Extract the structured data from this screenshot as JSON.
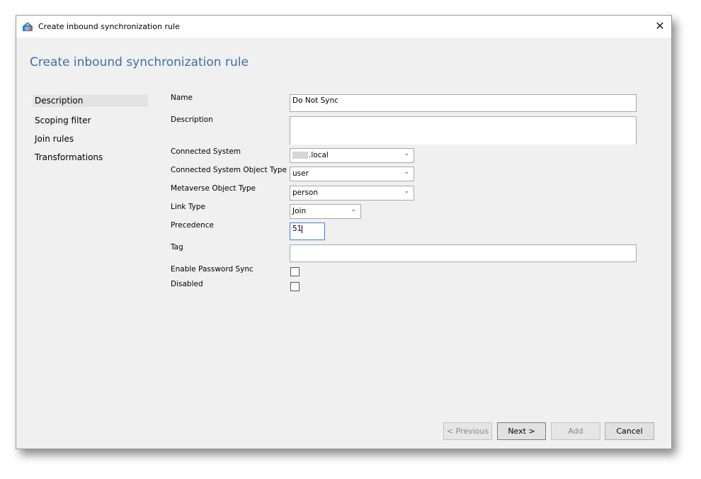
{
  "window": {
    "title": "Create inbound synchronization rule",
    "close_symbol": "✕"
  },
  "page": {
    "heading": "Create inbound synchronization rule"
  },
  "nav": {
    "items": [
      {
        "label": "Description",
        "active": true
      },
      {
        "label": "Scoping filter",
        "active": false
      },
      {
        "label": "Join rules",
        "active": false
      },
      {
        "label": "Transformations",
        "active": false
      }
    ]
  },
  "form": {
    "name_label": "Name",
    "name_value": "Do Not Sync",
    "description_label": "Description",
    "description_value": "",
    "connected_system_label": "Connected System",
    "connected_system_value": ".local",
    "cs_object_type_label": "Connected System Object Type",
    "cs_object_type_value": "user",
    "mv_object_type_label": "Metaverse Object Type",
    "mv_object_type_value": "person",
    "link_type_label": "Link Type",
    "link_type_value": "Join",
    "precedence_label": "Precedence",
    "precedence_value": "51",
    "tag_label": "Tag",
    "tag_value": "",
    "enable_password_sync_label": "Enable Password Sync",
    "enable_password_sync_checked": false,
    "disabled_label": "Disabled",
    "disabled_checked": false
  },
  "buttons": {
    "previous": "< Previous",
    "next": "Next >",
    "add": "Add",
    "cancel": "Cancel"
  },
  "colors": {
    "heading": "#3f6fa4",
    "client_bg": "#f0f0f0",
    "focus_border": "#3c7fd9"
  }
}
